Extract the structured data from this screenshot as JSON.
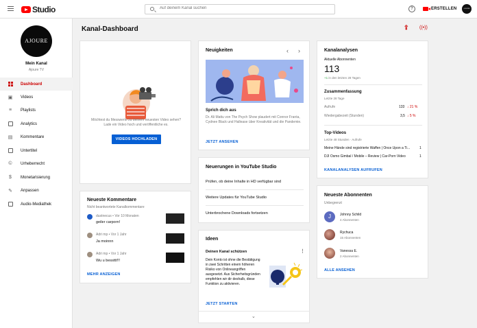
{
  "app": {
    "logo_text": "Studio"
  },
  "search": {
    "placeholder": "Auf deinem Kanal suchen"
  },
  "header": {
    "help_icon_glyph": "?",
    "create_label": "ERSTELLEN",
    "avatar_text": "AJOURE"
  },
  "channel": {
    "avatar_text": "AJOURE",
    "my_channel_label": "Mein Kanal",
    "channel_name": "Ajoure TV"
  },
  "sidebar": {
    "items": [
      {
        "label": "Dashboard",
        "icon": "dashboard-icon",
        "active": true
      },
      {
        "label": "Videos",
        "icon": "videos-icon"
      },
      {
        "label": "Playlists",
        "icon": "playlists-icon"
      },
      {
        "label": "Analytics",
        "icon": "analytics-icon"
      },
      {
        "label": "Kommentare",
        "icon": "comments-icon"
      },
      {
        "label": "Untertitel",
        "icon": "subtitles-icon"
      },
      {
        "label": "Urheberrecht",
        "icon": "copyright-icon"
      },
      {
        "label": "Monetarisierung",
        "icon": "dollar-icon"
      },
      {
        "label": "Anpassen",
        "icon": "magic-wand-icon"
      },
      {
        "label": "Audio-Mediathek",
        "icon": "audio-library-icon"
      }
    ]
  },
  "page": {
    "title": "Kanal-Dashboard"
  },
  "upload_card": {
    "text": "Möchtest du Messwerte zu deinem neuesten Video sehen? Lade ein Video hoch und veröffentliche es.",
    "button": "VIDEOS HOCHLADEN"
  },
  "comments_card": {
    "title": "Neueste Kommentare",
    "subtitle": "Nicht beantwortete Kanalkommentare",
    "items": [
      {
        "author": "dustnecus",
        "time": "Vor 10 Monaten",
        "text": "geiler carporn!"
      },
      {
        "author": "Adri mp",
        "time": "Vor 1 Jahr",
        "text": "Ja moinnn"
      },
      {
        "author": "Adri mp",
        "time": "Vor 1 Jahr",
        "text": "Wu u bessttt!!!"
      }
    ],
    "more": "MEHR ANZEIGEN"
  },
  "news_card": {
    "title": "Neuigkeiten",
    "headline": "Sprich dich aus",
    "text": "Dr. Ali Mattu von The Psych Show plaudert mit Connor Franta, Cydnee Black und Hallease über Kreativität und die Pandemie.",
    "action": "JETZT ANSEHEN"
  },
  "studio_news": {
    "title": "Neuerungen in YouTube Studio",
    "items": [
      "Prüfen, ob deine Inhalte in HD verfügbar sind",
      "Weitere Updates für YouTube Studio",
      "Unterbrochene Downloads fortsetzen"
    ]
  },
  "ideas_card": {
    "title": "Ideen",
    "subtitle": "Deinen Kanal schützen",
    "text": "Dein Konto ist ohne die Bestätigung in zwei Schritten einem höheren Risiko von Onlineangriffen ausgesetzt. Aus Sicherheitsgründen empfehlen wir dir deshalb, diese Funktion zu aktivieren.",
    "action": "JETZT STARTEN"
  },
  "analytics_card": {
    "title": "Kanalanalysen",
    "subs_label": "Aktuelle Abonnenten",
    "subs_value": "113",
    "subs_change": "+1",
    "subs_period": "in den letzten 28 Tagen",
    "summary_title": "Zusammenfassung",
    "summary_period": "Letzte 28 Tage",
    "rows": [
      {
        "label": "Aufrufe",
        "value": "133",
        "change": "21 %"
      },
      {
        "label": "Wiedergabezeit (Stunden)",
        "value": "3,5",
        "change": "5 %"
      }
    ],
    "top_title": "Top-Videos",
    "top_period": "Letzte 48 Stunden · Aufrufe",
    "top_videos": [
      {
        "title": "Meine Hände sind registrierte Waffen | Once Upon a Ti...",
        "views": "1"
      },
      {
        "title": "DJI Osmo Gimbal / Mobile – Review | Car-Porn Video",
        "views": "1"
      }
    ],
    "action": "KANALANALYSEN AUFRUFEN"
  },
  "subs_card": {
    "title": "Neueste Abonnenten",
    "subtitle": "Unbegrenzt",
    "items": [
      {
        "initial": "J",
        "name": "Johnny Schild",
        "count": "4 Abonnenten",
        "color": "#5c6bc0"
      },
      {
        "initial": "",
        "name": "Rychuca",
        "count": "15 Abonnenten",
        "color": "#8d4a3a"
      },
      {
        "initial": "",
        "name": "Vanessa E.",
        "count": "2 Abonnenten",
        "color": "#a06050"
      }
    ],
    "action": "ALLE ANSEHEN"
  },
  "colors": {
    "accent_red": "#cc0000",
    "link_blue": "#065fd4",
    "button_blue": "#065fd4"
  }
}
